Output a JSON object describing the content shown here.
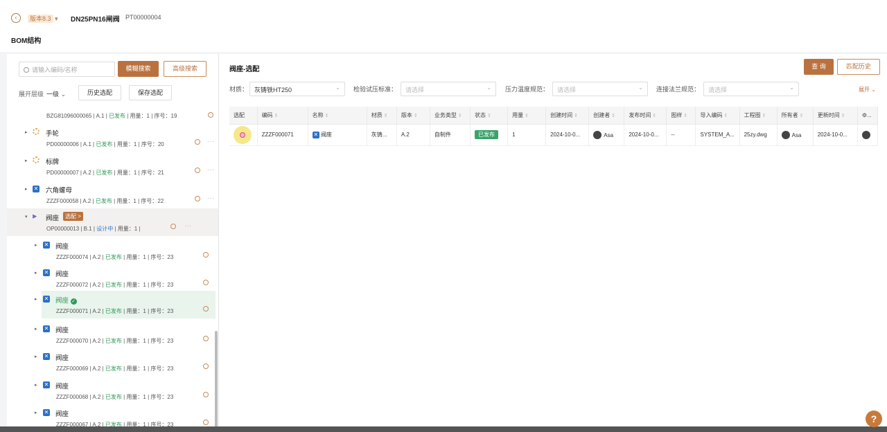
{
  "header": {
    "version": "版本8.3",
    "title": "DN25PN16闸阀",
    "code": "PT00000004",
    "bom_title": "BOM结构"
  },
  "left": {
    "search_placeholder": "请输入编码/名称",
    "fuzzy_btn": "模糊搜索",
    "advanced_btn": "高级搜索",
    "level_label": "展开层级",
    "level_value": "一级",
    "history_btn": "历史选配",
    "save_btn": "保存选配",
    "nodes": [
      {
        "name": "",
        "meta1": "BZG81096000065 | A.1 |",
        "status": "已发布",
        "meta2": "| 用量：1 | 序号：19"
      },
      {
        "name": "手轮",
        "meta1": "PD00000006 | A.1 |",
        "status": "已发布",
        "meta2": "| 用量：1 | 序号：20"
      },
      {
        "name": "标牌",
        "meta1": "PD00000007 | A.2 |",
        "status": "已发布",
        "meta2": "| 用量：1 | 序号：21"
      },
      {
        "name": "六角螺母",
        "meta1": "ZZZF000058 | A.2 |",
        "status": "已发布",
        "meta2": "| 用量：1 | 序号：22"
      },
      {
        "name": "阀座",
        "tag": "选配 >",
        "meta1": "OP00000013 | B.1 |",
        "status": "设计中",
        "meta2": "| 用量：1 |"
      },
      {
        "name": "阀座",
        "meta1": "ZZZF000074 | A.2 |",
        "status": "已发布",
        "meta2": "| 用量：1 | 序号：23"
      },
      {
        "name": "阀座",
        "meta1": "ZZZF000072 | A.2 |",
        "status": "已发布",
        "meta2": "| 用量：1 | 序号：23"
      },
      {
        "name": "阀座",
        "meta1": "ZZZF000071 | A.2 |",
        "status": "已发布",
        "meta2": "| 用量：1 | 序号：23"
      },
      {
        "name": "阀座",
        "meta1": "ZZZF000070 | A.2 |",
        "status": "已发布",
        "meta2": "| 用量：1 | 序号：23"
      },
      {
        "name": "阀座",
        "meta1": "ZZZF000069 | A.2 |",
        "status": "已发布",
        "meta2": "| 用量：1 | 序号：23"
      },
      {
        "name": "阀座",
        "meta1": "ZZZF000068 | A.2 |",
        "status": "已发布",
        "meta2": "| 用量：1 | 序号：23"
      },
      {
        "name": "阀座",
        "meta1": "ZZZF000067 | A.2 |",
        "status": "已发布",
        "meta2": "| 用量：1 | 序号：23"
      }
    ]
  },
  "right": {
    "title": "阀座-选配",
    "query_btn": "查 询",
    "history_btn": "匹配历史",
    "expand": "展开",
    "filters": [
      {
        "label": "材质：",
        "value": "灰铸铁HT250"
      },
      {
        "label": "检验试压标准：",
        "placeholder": "请选择"
      },
      {
        "label": "压力温度规范：",
        "placeholder": "请选择"
      },
      {
        "label": "连接法兰规范：",
        "placeholder": "请选择"
      }
    ],
    "columns": [
      "选配",
      "编码",
      "名称",
      "材质",
      "版本",
      "业务类型",
      "状态",
      "用量",
      "创建时间",
      "创建者",
      "发布时间",
      "图样",
      "导入编码",
      "工程图",
      "所有者",
      "更新时间",
      "..."
    ],
    "row": {
      "code": "ZZZF000071",
      "name": "阀座",
      "material": "灰铸...",
      "version": "A.2",
      "biz": "自制件",
      "status": "已发布",
      "qty": "1",
      "created": "2024-10-0...",
      "creator": "Asa",
      "published": "2024-10-0...",
      "drawing": "--",
      "import": "SYSTEM_A...",
      "eng": "25zy.dwg",
      "owner": "Asa",
      "updated": "2024-10-0..."
    }
  },
  "help": "?"
}
